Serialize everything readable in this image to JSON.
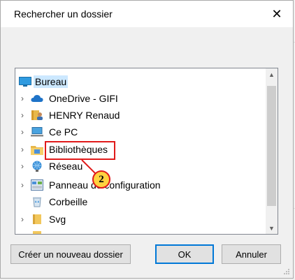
{
  "window": {
    "title": "Rechercher un dossier",
    "close_glyph": "✕"
  },
  "tree": {
    "items": [
      {
        "label": "Bureau",
        "icon": "desktop-icon",
        "expandable": false,
        "selected": true,
        "level": 0
      },
      {
        "label": "OneDrive - GIFI",
        "icon": "cloud-icon",
        "expandable": true,
        "level": 1
      },
      {
        "label": "HENRY Renaud",
        "icon": "user-folder-icon",
        "expandable": true,
        "level": 1
      },
      {
        "label": "Ce PC",
        "icon": "computer-icon",
        "expandable": true,
        "level": 1
      },
      {
        "label": "Bibliothèques",
        "icon": "library-folder-icon",
        "expandable": true,
        "level": 1
      },
      {
        "label": "Réseau",
        "icon": "network-icon",
        "expandable": true,
        "level": 1
      },
      {
        "label": "Panneau de configuration",
        "icon": "control-panel-icon",
        "expandable": true,
        "level": 1
      },
      {
        "label": "Corbeille",
        "icon": "recycle-bin-icon",
        "expandable": false,
        "level": 1
      },
      {
        "label": "Svg",
        "icon": "folder-icon",
        "expandable": true,
        "level": 1
      }
    ]
  },
  "annotation": {
    "badge_number": "2",
    "color": "#e01a1a",
    "badge_fill": "#ffd23f"
  },
  "buttons": {
    "new_folder": "Créer un nouveau dossier",
    "ok": "OK",
    "cancel": "Annuler"
  },
  "colors": {
    "selection": "#cce8ff",
    "accent": "#0078d7",
    "folder": "#e8b84a",
    "onedrive": "#1e73c8"
  }
}
